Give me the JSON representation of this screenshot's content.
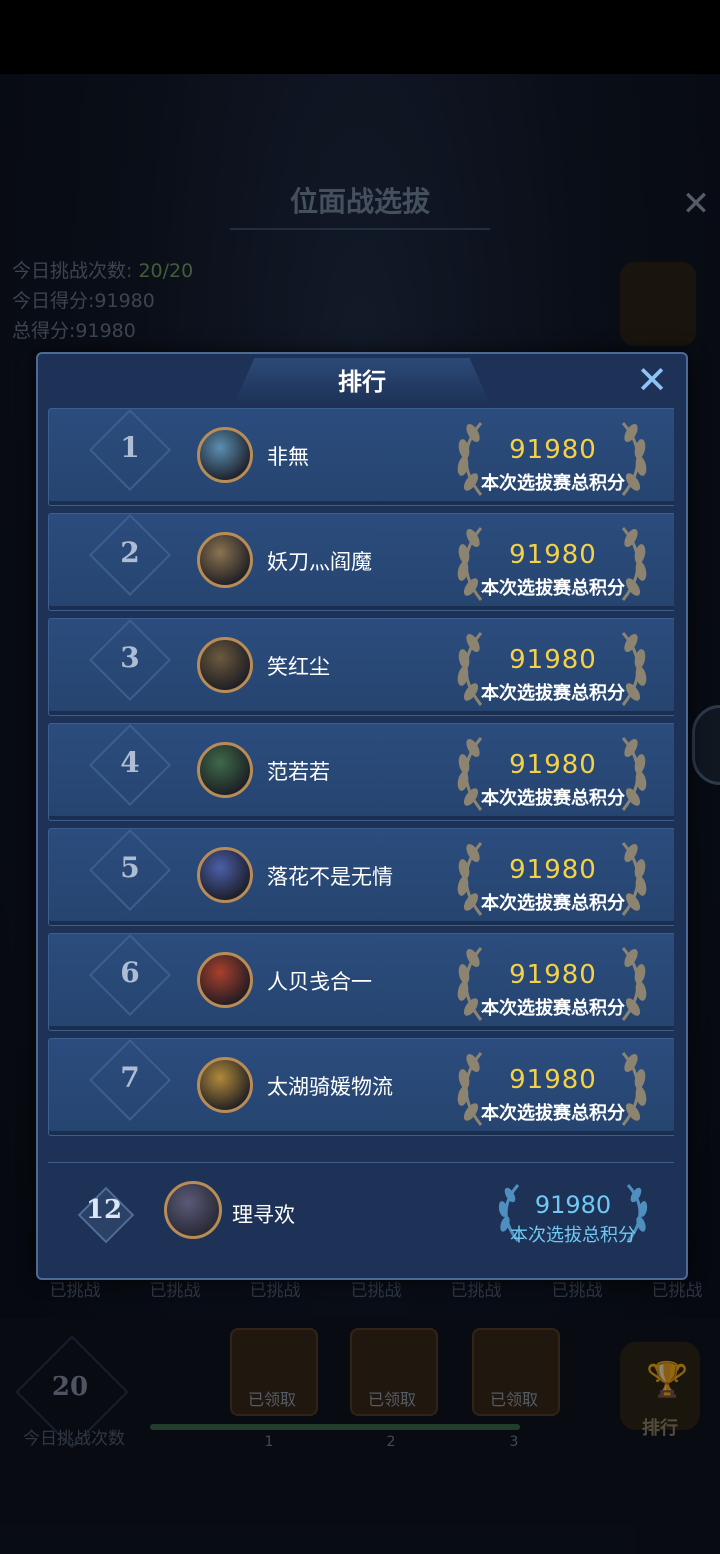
{
  "background": {
    "title": "位面战选拔",
    "stats": [
      {
        "label": "今日挑战次数: ",
        "value": "20/20"
      },
      {
        "label": "今日得分:",
        "value": "91980"
      },
      {
        "label": "总得分:",
        "value": "91980"
      }
    ],
    "challenged_labels": [
      "已挑战",
      "已挑战",
      "已挑战",
      "已挑战",
      "已挑战",
      "已挑战",
      "已挑战"
    ],
    "today_count": "20",
    "today_count_label": "今日挑战次数",
    "chests": [
      {
        "label": "已领取",
        "milestone": "1"
      },
      {
        "label": "已领取",
        "milestone": "2"
      },
      {
        "label": "已领取",
        "milestone": "3"
      }
    ],
    "progress_fraction": 1.0,
    "rank_button_label": "排行"
  },
  "modal": {
    "title": "排行",
    "close_icon": "close-icon",
    "rows": [
      {
        "rank": "1",
        "name": "非無",
        "score": "91980",
        "score_label": "本次选拔赛总积分",
        "avatar_color": "#5a8fb2"
      },
      {
        "rank": "2",
        "name": "妖刀灬阎魔",
        "score": "91980",
        "score_label": "本次选拔赛总积分",
        "avatar_color": "#8a7350"
      },
      {
        "rank": "3",
        "name": "笑红尘",
        "score": "91980",
        "score_label": "本次选拔赛总积分",
        "avatar_color": "#6b5a3e"
      },
      {
        "rank": "4",
        "name": "范若若",
        "score": "91980",
        "score_label": "本次选拔赛总积分",
        "avatar_color": "#3e6a4a"
      },
      {
        "rank": "5",
        "name": "落花不是无情",
        "score": "91980",
        "score_label": "本次选拔赛总积分",
        "avatar_color": "#4a5fa8"
      },
      {
        "rank": "6",
        "name": "人贝戋合一",
        "score": "91980",
        "score_label": "本次选拔赛总积分",
        "avatar_color": "#a8402c"
      },
      {
        "rank": "7",
        "name": "太湖骑媛物流",
        "score": "91980",
        "score_label": "本次选拔赛总积分",
        "avatar_color": "#b08a3a"
      }
    ],
    "self": {
      "rank": "12",
      "name": "理寻欢",
      "score": "91980",
      "score_label": "本次选拔总积分",
      "avatar_color": "#2c2c3a"
    }
  },
  "colors": {
    "score_gold": "#f4d146",
    "self_score_blue": "#6fc9f3",
    "row_bg": "#2b4c7e"
  }
}
